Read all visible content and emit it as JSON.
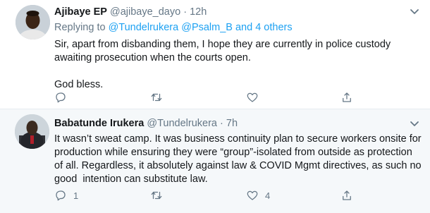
{
  "tweets": [
    {
      "name": "Ajibaye EP",
      "handle": "@ajibaye_dayo",
      "separator": "·",
      "time": "12h",
      "replying_prefix": "Replying to",
      "replying_to": "@Tundelrukera @Psalm_B and 4 others",
      "body_lines": [
        "Sir, apart from disbanding them, I hope they are currently in police custody",
        "awaiting prosecution when the courts open.",
        "God bless."
      ],
      "actions": {
        "reply_count": "",
        "retweet_count": "",
        "like_count": ""
      },
      "icons": [
        "reply-icon",
        "retweet-icon",
        "like-icon",
        "share-icon",
        "chevron-down-icon"
      ]
    },
    {
      "name": "Babatunde Irukera",
      "handle": "@Tundelrukera",
      "separator": "·",
      "time": "7h",
      "body_lines": [
        "It wasn’t sweat camp. It was business continuity plan to secure workers onsite for",
        "production while ensuring they were “group”-isolated from outside as protection",
        "of all. Regardless, it absolutely against law & COVID Mgmt directives, as such no",
        "good  intention can substitute law."
      ],
      "actions": {
        "reply_count": "1",
        "retweet_count": "",
        "like_count": "4"
      },
      "icons": [
        "reply-icon",
        "retweet-icon",
        "like-icon",
        "share-icon",
        "chevron-down-icon"
      ]
    }
  ],
  "colors": {
    "link": "#1da1f2",
    "secondary_text": "#657786",
    "primary_text": "#14171a",
    "highlight_bg": "#f5f8fa",
    "divider": "#e6ecf0"
  }
}
